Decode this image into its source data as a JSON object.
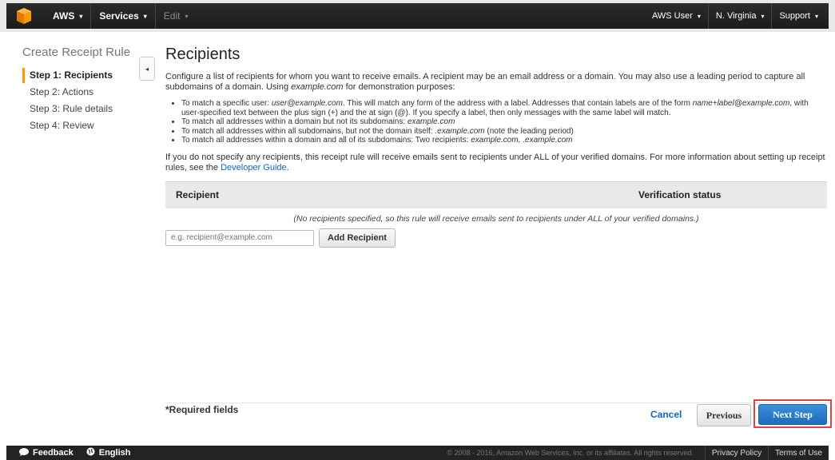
{
  "topbar": {
    "brand": "AWS",
    "services": "Services",
    "edit": "Edit",
    "user": "AWS User",
    "region": "N. Virginia",
    "support": "Support",
    "caret": "▾"
  },
  "sidebar": {
    "title": "Create Receipt Rule",
    "steps": [
      {
        "label": "Step 1: Recipients",
        "active": true
      },
      {
        "label": "Step 2: Actions"
      },
      {
        "label": "Step 3: Rule details"
      },
      {
        "label": "Step 4: Review"
      }
    ],
    "collapse_glyph": "◂"
  },
  "main": {
    "title": "Recipients",
    "intro_1": "Configure a list of recipients for whom you want to receive emails. A recipient may be an email address or a domain. You may also use a leading period to capture all subdomains of a domain. Using ",
    "intro_example": "example.com",
    "intro_2": " for demonstration purposes:",
    "rules": {
      "r1_a": "To match a specific user: ",
      "r1_b": "user@example.com",
      "r1_c": ". This will match any form of the address with a label. Addresses that contain labels are of the form ",
      "r1_d": "name+label@example.com",
      "r1_e": ", with user-specified text between the plus sign (+) and the at sign (@). If you specify a label, then only messages with the same label will match.",
      "r2_a": "To match all addresses within a domain but not its subdomains: ",
      "r2_b": "example.com",
      "r3_a": "To match all addresses within all subdomains, but not the domain itself: ",
      "r3_b": ".example.com",
      "r3_c": " (note the leading period)",
      "r4_a": "To match all addresses within a domain and all of its subdomains: Two recipients: ",
      "r4_b": "example.com, .example.com"
    },
    "note": "If you do not specify any recipients, this receipt rule will receive emails sent to recipients under ALL of your verified domains. For more information about setting up receipt rules, see the ",
    "note_link": "Developer Guide",
    "note_end": ".",
    "table": {
      "col_recipient": "Recipient",
      "col_status": "Verification status",
      "empty": "(No recipients specified, so this rule will receive emails sent to recipients under ALL of your verified domains.)"
    },
    "input_placeholder": "e.g. recipient@example.com",
    "add_button": "Add Recipient"
  },
  "footer": {
    "required": "*Required fields",
    "cancel": "Cancel",
    "previous": "Previous",
    "next": "Next Step"
  },
  "bottombar": {
    "feedback": "Feedback",
    "language": "English",
    "copyright": "© 2008 - 2016, Amazon Web Services, Inc. or its affiliates. All rights reserved.",
    "privacy": "Privacy Policy",
    "terms": "Terms of Use"
  },
  "colors": {
    "accent_orange": "#ff9900",
    "primary_blue": "#1f6cbd",
    "highlight_red": "#d9473f",
    "link_blue": "#1166bb"
  }
}
